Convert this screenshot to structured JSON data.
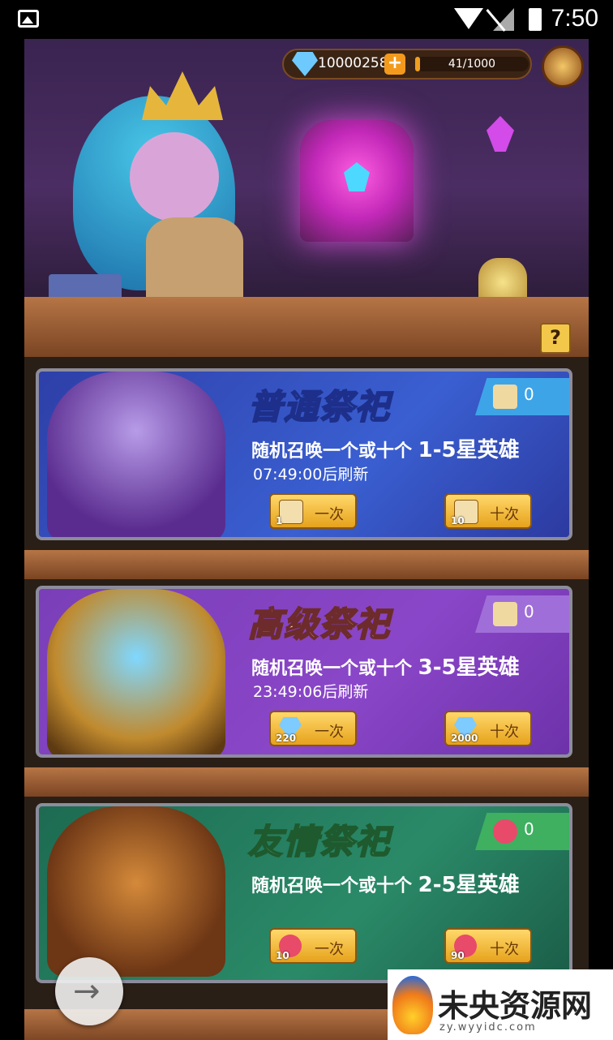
{
  "status_bar": {
    "time": "7:50"
  },
  "top_bar": {
    "diamonds": "100002589",
    "exp_text": "41/1000",
    "exp_fraction": 0.041
  },
  "help_label": "?",
  "cards": [
    {
      "title": "普通祭祀",
      "desc_prefix": "随机召唤一个或十个 ",
      "desc_stars": "1-5星英雄",
      "timer": "07:49:00后刷新",
      "ticket_count": "0",
      "one": {
        "cost": "1",
        "label": "一次"
      },
      "ten": {
        "cost": "10",
        "label": "十次"
      }
    },
    {
      "title": "高级祭祀",
      "desc_prefix": "随机召唤一个或十个 ",
      "desc_stars": "3-5星英雄",
      "timer": "23:49:06后刷新",
      "ticket_count": "0",
      "one": {
        "cost": "220",
        "label": "一次"
      },
      "ten": {
        "cost": "2000",
        "label": "十次"
      }
    },
    {
      "title": "友情祭祀",
      "desc_prefix": "随机召唤一个或十个 ",
      "desc_stars": "2-5星英雄",
      "timer": "",
      "ticket_count": "0",
      "one": {
        "cost": "10",
        "label": "一次"
      },
      "ten": {
        "cost": "90",
        "label": "十次"
      }
    }
  ],
  "fab_icon": "→",
  "watermark": {
    "text": "未央资源网",
    "url": "zy.wyyidc.com"
  },
  "icons": {
    "back": "arrow-right-icon",
    "diamond": "diamond-icon",
    "plus": "plus-icon",
    "scroll": "scroll-icon",
    "heart": "heart-icon"
  }
}
